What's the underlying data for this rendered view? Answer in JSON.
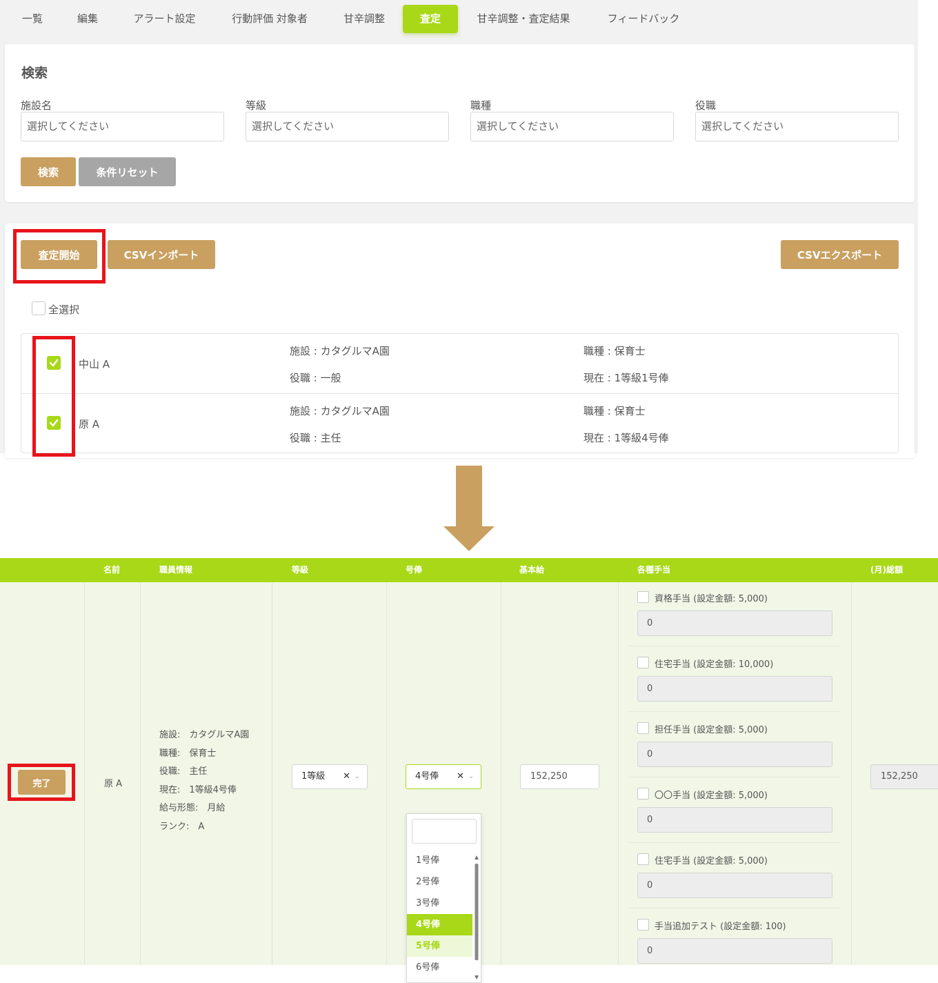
{
  "tabs": [
    "一覧",
    "編集",
    "アラート設定",
    "行動評価 対象者",
    "甘辛調整",
    "査定",
    "甘辛調整・査定結果",
    "フィードバック"
  ],
  "active_tab": "査定",
  "search": {
    "title": "検索",
    "fields": [
      {
        "label": "施設名",
        "placeholder": "選択してください"
      },
      {
        "label": "等級",
        "placeholder": "選択してください"
      },
      {
        "label": "職種",
        "placeholder": "選択してください"
      },
      {
        "label": "役職",
        "placeholder": "選択してください"
      }
    ],
    "search_button": "検索",
    "reset_button": "条件リセット"
  },
  "actions": {
    "start_button": "査定開始",
    "csv_import_button": "CSVインポート",
    "csv_export_button": "CSVエクスポート",
    "select_all_label": "全選択"
  },
  "staff": [
    {
      "name": "中山 A",
      "facility": "施設 : カタグルマA園",
      "position": "役職 : 一般",
      "job": "職種 : 保育士",
      "current": "現在 : 1等級1号俸",
      "checked": true
    },
    {
      "name": "原 A",
      "facility": "施設 : カタグルマA園",
      "position": "役職 : 主任",
      "job": "職種 : 保育士",
      "current": "現在 : 1等級4号俸",
      "checked": true
    }
  ],
  "table": {
    "headers": [
      "名前",
      "職員情報",
      "等級",
      "号俸",
      "基本給",
      "各種手当",
      "(月)総額"
    ],
    "row": {
      "complete_button": "完了",
      "name": "原 A",
      "info": [
        "施設:　カタグルマA園",
        "職種:　保育士",
        "役職:　主任",
        "現在:　1等級4号俸",
        "給与形態:　月給",
        "ランク:　A"
      ],
      "grade": "1等級",
      "step": "4号俸",
      "base_salary": "152,250",
      "total": "152,250",
      "allowances": [
        {
          "label": "資格手当 (設定金額: 5,000)",
          "value": "0"
        },
        {
          "label": "住宅手当 (設定金額: 10,000)",
          "value": "0"
        },
        {
          "label": "担任手当 (設定金額: 5,000)",
          "value": "0"
        },
        {
          "label": "〇〇手当 (設定金額: 5,000)",
          "value": "0"
        },
        {
          "label": "住宅手当 (設定金額: 5,000)",
          "value": "0"
        },
        {
          "label": "手当追加テスト (設定金額: 100)",
          "value": "0"
        }
      ]
    },
    "step_options": [
      "1号俸",
      "2号俸",
      "3号俸",
      "4号俸",
      "5号俸",
      "6号俸"
    ],
    "step_selected": "4号俸",
    "step_hovered": "5号俸",
    "clear_symbol": "✕",
    "chevron_symbol": "⌄"
  },
  "colors": {
    "accent": "#a8d818",
    "gold": "#c9a060",
    "highlight": "#e8141b"
  }
}
